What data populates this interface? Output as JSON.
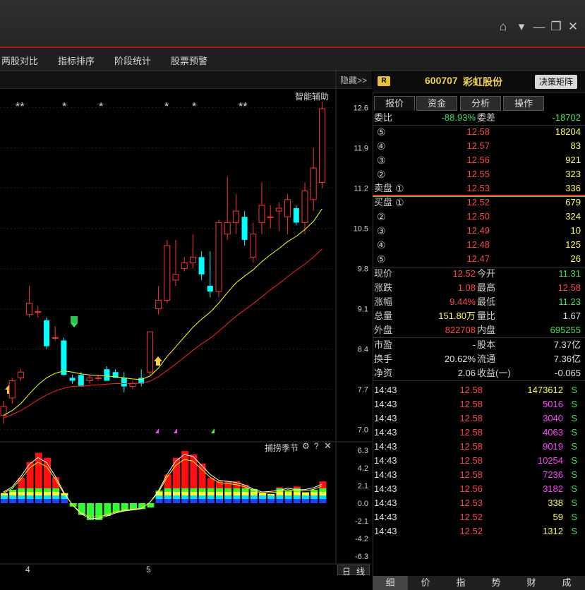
{
  "window": {
    "controls": [
      "home-icon",
      "chevron-down-icon",
      "minimize-icon",
      "restore-icon",
      "close-icon"
    ]
  },
  "toolbar": {
    "items": [
      "两股对比",
      "指标排序",
      "阶段统计",
      "股票预警"
    ]
  },
  "chart": {
    "hide_label": "隐藏>>",
    "assist_label": "智能辅助",
    "star_marks": [
      "**",
      "*",
      "*",
      "*",
      "*",
      "**"
    ],
    "price_ticks": [
      "12.6",
      "11.9",
      "11.2",
      "10.5",
      "9.8",
      "9.1",
      "8.4",
      "7.7",
      "7.0"
    ],
    "indicator_title": "捕捞季节",
    "indicator_ticks": [
      "6.3",
      "4.2",
      "2.1",
      "0.0",
      "-2.1",
      "-4.2",
      "-6.3"
    ],
    "x_labels": [
      "4",
      "5"
    ],
    "period_labels": [
      "日",
      "线"
    ],
    "colors": {
      "up": "#ff3232",
      "down": "#00ffff",
      "ma_fast": "#ffff00",
      "ma_slow": "#ff2020",
      "grid": "#222"
    }
  },
  "chart_data": {
    "type": "candlestick",
    "ylim": [
      6.8,
      12.9
    ],
    "candles": [
      {
        "o": 7.25,
        "h": 7.5,
        "l": 7.1,
        "c": 7.4
      },
      {
        "o": 7.55,
        "h": 7.9,
        "l": 7.45,
        "c": 7.85
      },
      {
        "o": 7.9,
        "h": 8.05,
        "l": 7.85,
        "c": 8.0
      },
      {
        "o": 9.0,
        "h": 9.5,
        "l": 8.95,
        "c": 9.2
      },
      {
        "o": 9.05,
        "h": 9.15,
        "l": 8.95,
        "c": 9.05
      },
      {
        "o": 8.9,
        "h": 8.95,
        "l": 8.4,
        "c": 8.45
      },
      {
        "o": 8.6,
        "h": 8.8,
        "l": 8.55,
        "c": 8.6
      },
      {
        "o": 8.55,
        "h": 8.6,
        "l": 7.95,
        "c": 7.95
      },
      {
        "o": 7.9,
        "h": 7.95,
        "l": 7.8,
        "c": 7.85
      },
      {
        "o": 7.95,
        "h": 8.0,
        "l": 7.75,
        "c": 7.75
      },
      {
        "o": 7.85,
        "h": 7.95,
        "l": 7.8,
        "c": 7.9
      },
      {
        "o": 7.9,
        "h": 7.95,
        "l": 7.85,
        "c": 7.9
      },
      {
        "o": 8.05,
        "h": 8.1,
        "l": 7.85,
        "c": 7.85
      },
      {
        "o": 8.0,
        "h": 8.05,
        "l": 7.9,
        "c": 7.9
      },
      {
        "o": 7.9,
        "h": 8.0,
        "l": 7.65,
        "c": 7.75
      },
      {
        "o": 7.75,
        "h": 7.85,
        "l": 7.7,
        "c": 7.8
      },
      {
        "o": 7.9,
        "h": 8.05,
        "l": 7.75,
        "c": 7.8
      },
      {
        "o": 8.0,
        "h": 8.7,
        "l": 7.95,
        "c": 8.7
      },
      {
        "o": 9.1,
        "h": 9.5,
        "l": 9.0,
        "c": 9.25
      },
      {
        "o": 9.25,
        "h": 10.3,
        "l": 9.2,
        "c": 10.2
      },
      {
        "o": 9.6,
        "h": 10.3,
        "l": 9.5,
        "c": 9.7
      },
      {
        "o": 9.8,
        "h": 10.0,
        "l": 9.75,
        "c": 9.9
      },
      {
        "o": 9.9,
        "h": 10.4,
        "l": 9.8,
        "c": 10.0
      },
      {
        "o": 10.0,
        "h": 10.1,
        "l": 9.6,
        "c": 9.7
      },
      {
        "o": 9.5,
        "h": 10.1,
        "l": 9.3,
        "c": 9.4
      },
      {
        "o": 9.4,
        "h": 10.65,
        "l": 9.3,
        "c": 10.6
      },
      {
        "o": 10.4,
        "h": 11.4,
        "l": 10.3,
        "c": 10.6
      },
      {
        "o": 10.6,
        "h": 11.1,
        "l": 10.4,
        "c": 10.8
      },
      {
        "o": 10.7,
        "h": 10.8,
        "l": 10.2,
        "c": 10.3
      },
      {
        "o": 10.0,
        "h": 10.6,
        "l": 9.9,
        "c": 10.4
      },
      {
        "o": 10.6,
        "h": 11.3,
        "l": 10.4,
        "c": 10.9
      },
      {
        "o": 10.7,
        "h": 10.9,
        "l": 10.5,
        "c": 10.7
      },
      {
        "o": 10.8,
        "h": 10.95,
        "l": 10.45,
        "c": 10.85
      },
      {
        "o": 10.7,
        "h": 11.1,
        "l": 10.4,
        "c": 11.0
      },
      {
        "o": 10.85,
        "h": 10.9,
        "l": 10.55,
        "c": 10.6
      },
      {
        "o": 10.6,
        "h": 11.3,
        "l": 10.4,
        "c": 11.15
      },
      {
        "o": 11.0,
        "h": 11.9,
        "l": 10.8,
        "c": 11.55
      },
      {
        "o": 11.3,
        "h": 12.7,
        "l": 11.2,
        "c": 12.58
      }
    ],
    "ma_fast": [
      7.25,
      7.33,
      7.45,
      7.62,
      7.78,
      7.9,
      7.98,
      8.02,
      8.0,
      7.97,
      7.95,
      7.94,
      7.93,
      7.92,
      7.9,
      7.88,
      7.87,
      7.93,
      8.07,
      8.27,
      8.44,
      8.61,
      8.78,
      8.92,
      9.04,
      9.2,
      9.38,
      9.55,
      9.67,
      9.78,
      9.92,
      10.04,
      10.15,
      10.27,
      10.36,
      10.48,
      10.62,
      10.84
    ],
    "ma_slow": [
      7.2,
      7.26,
      7.33,
      7.42,
      7.52,
      7.6,
      7.67,
      7.72,
      7.75,
      7.76,
      7.77,
      7.78,
      7.79,
      7.8,
      7.8,
      7.8,
      7.81,
      7.84,
      7.92,
      8.03,
      8.14,
      8.26,
      8.38,
      8.49,
      8.59,
      8.71,
      8.84,
      8.97,
      9.08,
      9.19,
      9.31,
      9.43,
      9.54,
      9.66,
      9.77,
      9.88,
      10.0,
      10.14
    ],
    "indicator_bars": [
      1.2,
      1.6,
      3.0,
      4.9,
      6.0,
      5.4,
      3.1,
      1.2,
      -0.4,
      -1.4,
      -2.0,
      -2.0,
      -1.5,
      -1.1,
      -0.9,
      -0.8,
      -0.7,
      -0.5,
      1.5,
      3.4,
      5.4,
      6.2,
      5.8,
      4.7,
      3.0,
      2.6,
      2.6,
      2.6,
      2.2,
      1.7,
      1.2,
      1.1,
      1.9,
      1.5,
      2.0,
      1.3,
      1.6,
      2.6
    ]
  },
  "quote": {
    "badge": "R",
    "code": "600707",
    "name": "彩虹股份",
    "decision_btn": "决策矩阵",
    "tabs": [
      "报价",
      "资金",
      "分析",
      "操作"
    ],
    "weibi_label": "委比",
    "weibi_val": "-88.93%",
    "weicha_label": "委差",
    "weicha_val": "-18702",
    "sell_label": "卖盘",
    "buy_label": "买盘",
    "asks": [
      {
        "lvl": "⑤",
        "price": "12.58",
        "vol": "18204"
      },
      {
        "lvl": "④",
        "price": "12.57",
        "vol": "83"
      },
      {
        "lvl": "③",
        "price": "12.56",
        "vol": "921"
      },
      {
        "lvl": "②",
        "price": "12.55",
        "vol": "323"
      },
      {
        "lvl": "①",
        "price": "12.53",
        "vol": "336"
      }
    ],
    "bids": [
      {
        "lvl": "①",
        "price": "12.52",
        "vol": "679"
      },
      {
        "lvl": "②",
        "price": "12.50",
        "vol": "324"
      },
      {
        "lvl": "③",
        "price": "12.49",
        "vol": "10"
      },
      {
        "lvl": "④",
        "price": "12.48",
        "vol": "125"
      },
      {
        "lvl": "⑤",
        "price": "12.47",
        "vol": "26"
      }
    ],
    "stats": [
      {
        "l1": "现价",
        "v1": "12.52",
        "c1": "red",
        "l2": "今开",
        "v2": "11.31",
        "c2": "green"
      },
      {
        "l1": "涨跌",
        "v1": "1.08",
        "c1": "red",
        "l2": "最高",
        "v2": "12.58",
        "c2": "red"
      },
      {
        "l1": "涨幅",
        "v1": "9.44%",
        "c1": "red",
        "l2": "最低",
        "v2": "11.23",
        "c2": "green"
      },
      {
        "l1": "总量",
        "v1": "151.80万",
        "c1": "yellow",
        "l2": "量比",
        "v2": "1.67",
        "c2": "white"
      },
      {
        "l1": "外盘",
        "v1": "822708",
        "c1": "red",
        "l2": "内盘",
        "v2": "695255",
        "c2": "green"
      }
    ],
    "fund": [
      {
        "l1": "市盈",
        "v1": "-",
        "l2": "股本",
        "v2": "7.37亿"
      },
      {
        "l1": "换手",
        "v1": "20.62%",
        "l2": "流通",
        "v2": "7.36亿"
      },
      {
        "l1": "净资",
        "v1": "2.06",
        "l2": "收益(一)",
        "v2": "-0.065"
      }
    ],
    "ticks": [
      {
        "t": "14:43",
        "p": "12.58",
        "v": "1473612",
        "vc": "yellow",
        "s": "S"
      },
      {
        "t": "14:43",
        "p": "12.58",
        "v": "5016",
        "vc": "magenta",
        "s": "S"
      },
      {
        "t": "14:43",
        "p": "12.58",
        "v": "3040",
        "vc": "magenta",
        "s": "S"
      },
      {
        "t": "14:43",
        "p": "12.58",
        "v": "4063",
        "vc": "magenta",
        "s": "S"
      },
      {
        "t": "14:43",
        "p": "12.58",
        "v": "9019",
        "vc": "magenta",
        "s": "S"
      },
      {
        "t": "14:43",
        "p": "12.58",
        "v": "10254",
        "vc": "magenta",
        "s": "S"
      },
      {
        "t": "14:43",
        "p": "12.58",
        "v": "7236",
        "vc": "magenta",
        "s": "S"
      },
      {
        "t": "14:43",
        "p": "12.56",
        "v": "3182",
        "vc": "magenta",
        "s": "S"
      },
      {
        "t": "14:43",
        "p": "12.53",
        "v": "338",
        "vc": "yellow",
        "s": "S"
      },
      {
        "t": "14:43",
        "p": "12.52",
        "v": "59",
        "vc": "yellow",
        "s": "S"
      },
      {
        "t": "14:43",
        "p": "12.52",
        "v": "1312",
        "vc": "yellow",
        "s": "S"
      }
    ],
    "bottom_tabs": [
      "细",
      "价",
      "指",
      "势",
      "财",
      "成"
    ]
  }
}
